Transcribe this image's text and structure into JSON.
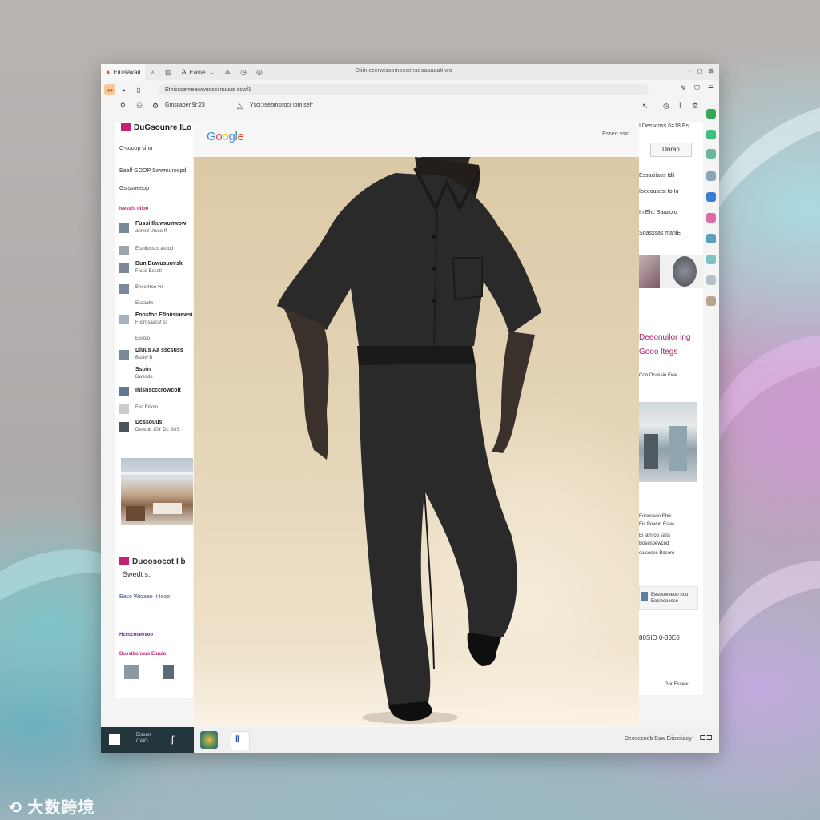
{
  "browser": {
    "tabs": [
      {
        "label": "Eiuisaxail",
        "icon": "firefox-icon"
      },
      {
        "label": "Easie",
        "icon": "font-icon"
      }
    ],
    "center_title": "Diiinicccrwissomocccnsosaaaaatiiwo",
    "address": "Ethissoemeawwoossiinuuud scwf1",
    "bookmarks": [
      "Gmsiiaoer 9r:23",
      "Ysoi:iisebinssocr iom:sefr"
    ]
  },
  "sidebar": {
    "header": "DuGsounre ILo",
    "line1": "C-cooop sinu",
    "line2": "Eaaff GOOP Swwmuroopd",
    "line3": "Gsissoeeop",
    "section_title": "Ivessfs oiioo",
    "items": [
      {
        "title": "Fussi Ikuwxunwow",
        "sub": "anned Ursso If"
      },
      {
        "title": "",
        "sub": "Eisniiusscc assod"
      },
      {
        "title": "Bun Buwusuuvsk",
        "sub": "Fuuio Essoll"
      },
      {
        "title": "",
        "sub": "Bnso Hoo vn"
      },
      {
        "title": "",
        "sub": "Essaidw"
      },
      {
        "title": "Foosfoc Eflniisiuewsi",
        "sub": "Fusrnsaacsf ss"
      },
      {
        "title": "",
        "sub": "Essoio"
      },
      {
        "title": "Diuus Aa sscsuss",
        "sub": "Bssiw B"
      },
      {
        "title": "Ssoin",
        "sub": "Dwesde"
      },
      {
        "title": "Ihisnscccrowcoit",
        "sub": ""
      },
      {
        "title": "",
        "sub": "Fes Eisoin"
      },
      {
        "title": "Dcssouus",
        "sub": "Dsosub 10Y Dc SUS"
      }
    ],
    "promo_title": "Duoosocot I b",
    "promo_sub": "Swedt s.",
    "footer_link": "Easo  Wioaao Ir Isoo",
    "sec2_title": "Hccccoceesoo",
    "sec2_sub": "Dussibonnuo Eiuuio"
  },
  "main": {
    "logo": [
      "G",
      "o",
      "o",
      "g",
      "l",
      "e"
    ],
    "logo_colors": [
      "#4285F4",
      "#EA4335",
      "#FBBC05",
      "#4285F4",
      "#34A853",
      "#EA4335"
    ],
    "top_right": "Esseo ssid"
  },
  "right_panel": {
    "top_line": "I Desscoss 6=18 Es",
    "button": "Dnran",
    "lines": [
      "Essaciiaos Idii",
      "Ioeeoussst fo Iu",
      "In Ehc Saaaoio",
      "Soasssas maniE"
    ],
    "headline1": "Deeonuilor ing",
    "headline2": "Gooo ltegs",
    "small1": "Coo Ocossio Ewe",
    "text_block": [
      "Eoooseoo Ehw",
      "Eic Bowon Essw",
      "Ei sbn oo sass",
      "Bosesoewcod",
      "oiusoses Bosoro"
    ],
    "card_text": "Eesooweeoo noo Eosiocoesse",
    "price": "80SIO  0-33E0",
    "footer": "Gor Essew"
  },
  "taskbar": {
    "start_label_1": "Eisoon",
    "start_label_2": "CAIO",
    "tray": "Deosecoeb Bsw Eiiossiaey"
  },
  "watermark": "大数跨境"
}
